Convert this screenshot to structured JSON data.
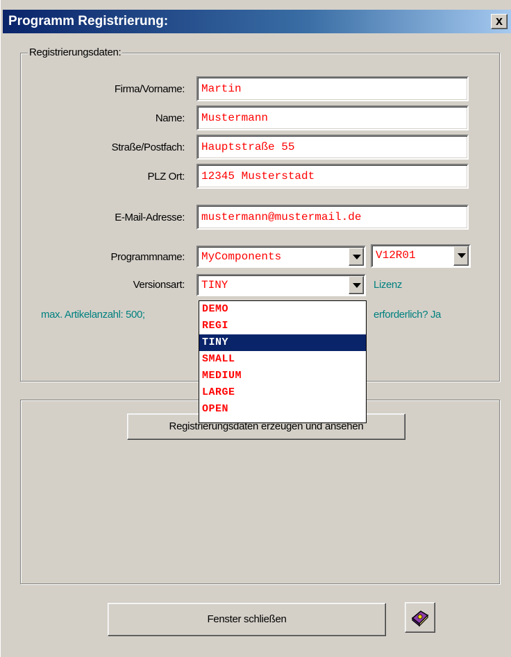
{
  "window": {
    "title": "Programm Registrierung:",
    "close_label": "x"
  },
  "registration_group": {
    "legend": "Registrierungsdaten:",
    "fields": {
      "firma_label": "Firma/Vorname:",
      "firma_value": "Martin",
      "name_label": "Name:",
      "name_value": "Mustermann",
      "strasse_label": "Straße/Postfach:",
      "strasse_value": "Hauptstraße 55",
      "plz_label": "PLZ Ort:",
      "plz_value": "12345 Musterstadt",
      "email_label": "E-Mail-Adresse:",
      "email_value": "mustermann@mustermail.de"
    },
    "programmname_label": "Programmname:",
    "programmname_value": "MyComponents",
    "version_value": "V12R01",
    "versionsart_label": "Versionsart:",
    "versionsart_value": "TINY",
    "lizenz_label": "Lizenz",
    "info_text": "max. Artikelanzahl: 500;",
    "info_text_right": "erforderlich? Ja",
    "versionsart_options": [
      "DEMO",
      "REGI",
      "TINY",
      "SMALL",
      "MEDIUM",
      "LARGE",
      "OPEN"
    ],
    "versionsart_selected": "TINY"
  },
  "output_group": {
    "generate_button": "Registrierungsdaten erzeugen und ansehen"
  },
  "footer": {
    "close_button": "Fenster schließen",
    "help_icon": "help-book-icon"
  },
  "colors": {
    "titlebar_start": "#0a246a",
    "titlebar_end": "#a6caf0",
    "field_text": "#ff0000",
    "info_text": "#00807f",
    "dialog_bg": "#d4d0c8",
    "selection": "#0a246a"
  }
}
